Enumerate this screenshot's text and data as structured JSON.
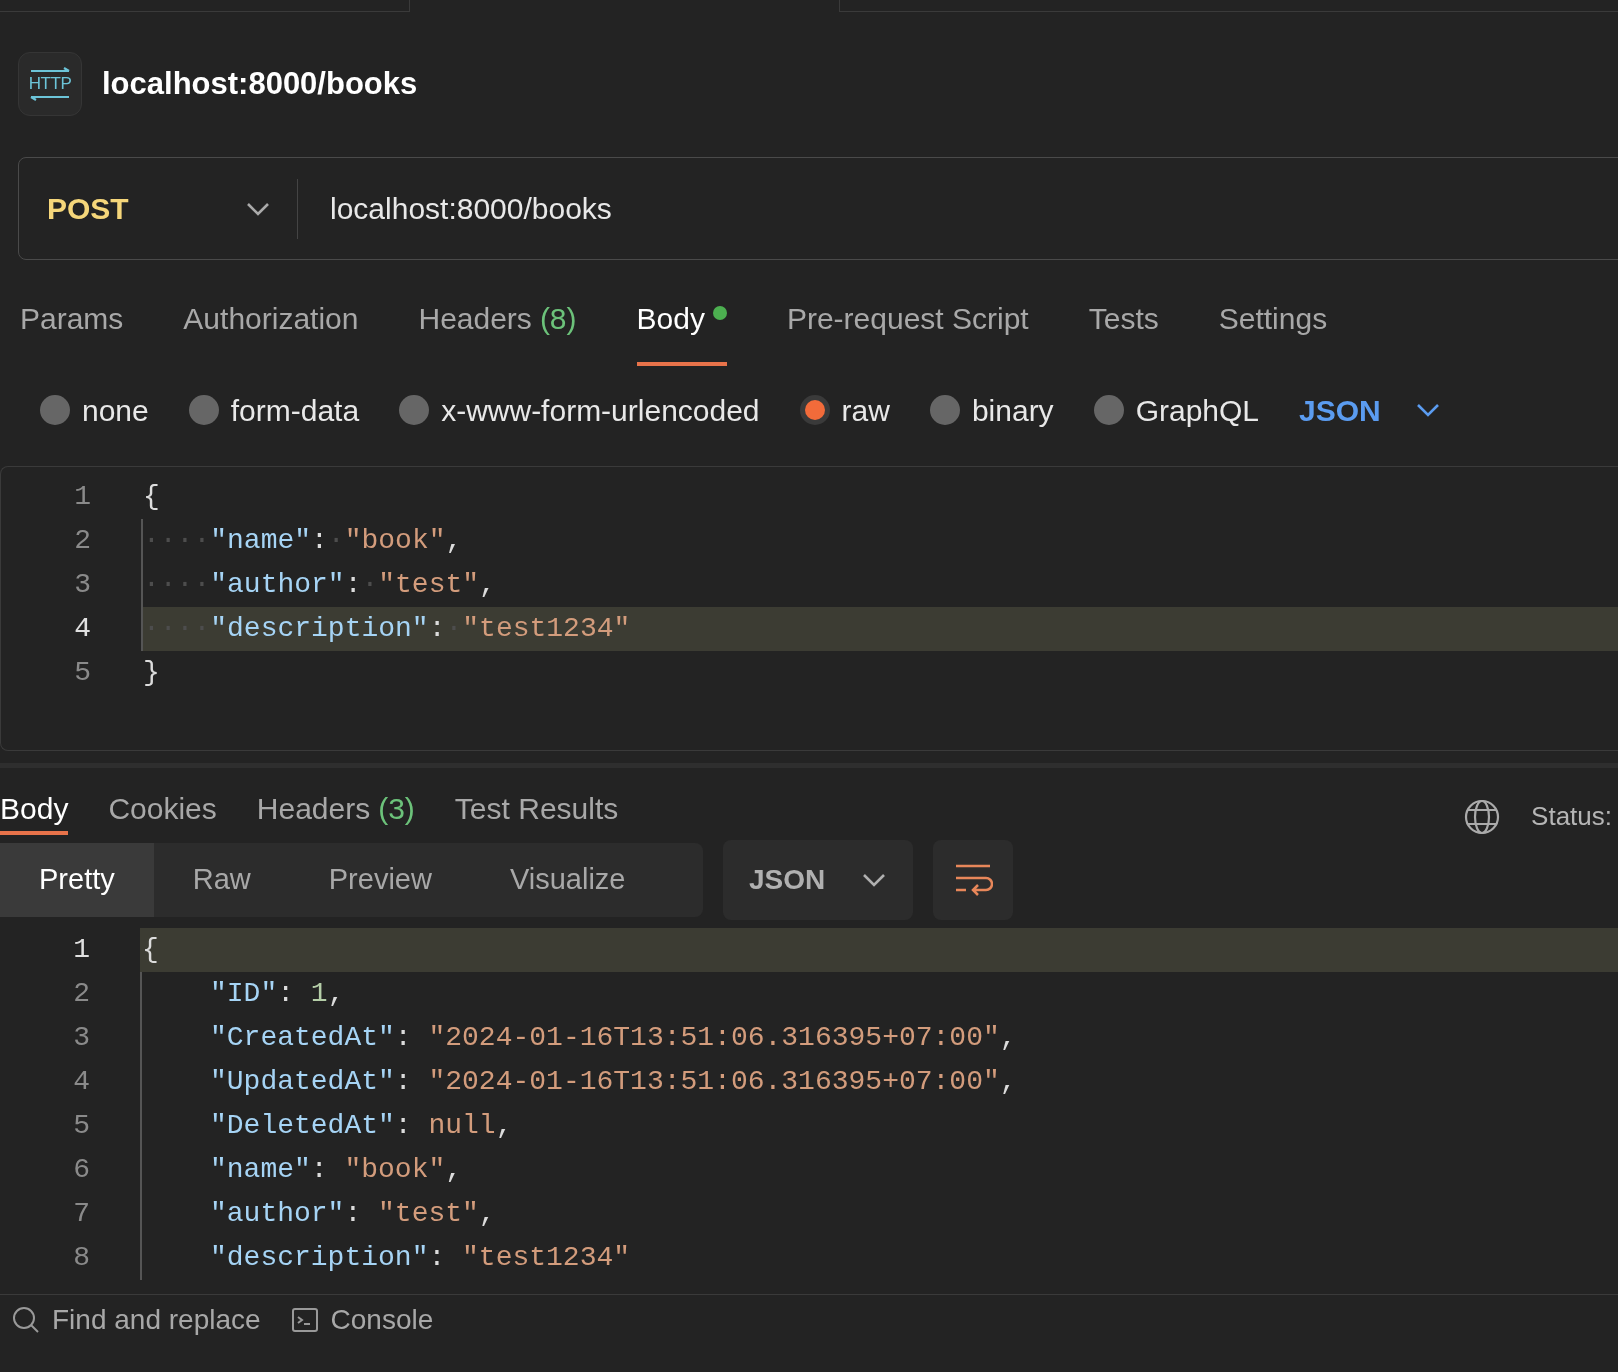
{
  "request": {
    "icon_text": "HTTP",
    "title": "localhost:8000/books",
    "method": "POST",
    "url": "localhost:8000/books",
    "tabs": [
      {
        "label": "Params",
        "selected": false
      },
      {
        "label": "Authorization",
        "selected": false
      },
      {
        "label": "Headers",
        "count": "(8)",
        "selected": false
      },
      {
        "label": "Body",
        "indicator": true,
        "selected": true
      },
      {
        "label": "Pre-request Script",
        "selected": false
      },
      {
        "label": "Tests",
        "selected": false
      },
      {
        "label": "Settings",
        "selected": false
      }
    ],
    "body_types": [
      {
        "label": "none",
        "selected": false
      },
      {
        "label": "form-data",
        "selected": false
      },
      {
        "label": "x-www-form-urlencoded",
        "selected": false
      },
      {
        "label": "raw",
        "selected": true
      },
      {
        "label": "binary",
        "selected": false
      },
      {
        "label": "GraphQL",
        "selected": false
      }
    ],
    "format": "JSON",
    "editor": {
      "lines": [
        {
          "number": "1",
          "highlighted": false,
          "tokens": [
            {
              "kind": "punct",
              "text": "{"
            }
          ]
        },
        {
          "number": "2",
          "highlighted": false,
          "tokens": [
            {
              "kind": "ws",
              "text": "····"
            },
            {
              "kind": "key",
              "text": "\"name\""
            },
            {
              "kind": "punct",
              "text": ":"
            },
            {
              "kind": "ws",
              "text": "·"
            },
            {
              "kind": "string",
              "text": "\"book\""
            },
            {
              "kind": "punct",
              "text": ","
            }
          ]
        },
        {
          "number": "3",
          "highlighted": false,
          "tokens": [
            {
              "kind": "ws",
              "text": "····"
            },
            {
              "kind": "key",
              "text": "\"author\""
            },
            {
              "kind": "punct",
              "text": ":"
            },
            {
              "kind": "ws",
              "text": "·"
            },
            {
              "kind": "string",
              "text": "\"test\""
            },
            {
              "kind": "punct",
              "text": ","
            }
          ]
        },
        {
          "number": "4",
          "highlighted": true,
          "tokens": [
            {
              "kind": "ws",
              "text": "····"
            },
            {
              "kind": "key",
              "text": "\"description\""
            },
            {
              "kind": "punct",
              "text": ":"
            },
            {
              "kind": "ws",
              "text": "·"
            },
            {
              "kind": "string",
              "text": "\"test1234\""
            }
          ]
        },
        {
          "number": "5",
          "highlighted": false,
          "tokens": [
            {
              "kind": "punct",
              "text": "}"
            }
          ]
        }
      ]
    }
  },
  "response": {
    "tabs": [
      {
        "label": "Body",
        "selected": true
      },
      {
        "label": "Cookies",
        "selected": false
      },
      {
        "label": "Headers",
        "count": "(3)",
        "selected": false
      },
      {
        "label": "Test Results",
        "selected": false
      }
    ],
    "status_label": "Status:",
    "view_modes": [
      {
        "label": "Pretty",
        "selected": true
      },
      {
        "label": "Raw",
        "selected": false
      },
      {
        "label": "Preview",
        "selected": false
      },
      {
        "label": "Visualize",
        "selected": false
      }
    ],
    "format": "JSON",
    "editor": {
      "lines": [
        {
          "number": "1",
          "highlighted": true,
          "tokens": [
            {
              "kind": "punct",
              "text": "{"
            }
          ]
        },
        {
          "number": "2",
          "highlighted": false,
          "indented": true,
          "tokens": [
            {
              "kind": "key",
              "text": "\"ID\""
            },
            {
              "kind": "punct",
              "text": ": "
            },
            {
              "kind": "number",
              "text": "1"
            },
            {
              "kind": "punct",
              "text": ","
            }
          ]
        },
        {
          "number": "3",
          "highlighted": false,
          "indented": true,
          "tokens": [
            {
              "kind": "key",
              "text": "\"CreatedAt\""
            },
            {
              "kind": "punct",
              "text": ": "
            },
            {
              "kind": "string",
              "text": "\"2024-01-16T13:51:06.316395+07:00\""
            },
            {
              "kind": "punct",
              "text": ","
            }
          ]
        },
        {
          "number": "4",
          "highlighted": false,
          "indented": true,
          "tokens": [
            {
              "kind": "key",
              "text": "\"UpdatedAt\""
            },
            {
              "kind": "punct",
              "text": ": "
            },
            {
              "kind": "string",
              "text": "\"2024-01-16T13:51:06.316395+07:00\""
            },
            {
              "kind": "punct",
              "text": ","
            }
          ]
        },
        {
          "number": "5",
          "highlighted": false,
          "indented": true,
          "tokens": [
            {
              "kind": "key",
              "text": "\"DeletedAt\""
            },
            {
              "kind": "punct",
              "text": ": "
            },
            {
              "kind": "null",
              "text": "null"
            },
            {
              "kind": "punct",
              "text": ","
            }
          ]
        },
        {
          "number": "6",
          "highlighted": false,
          "indented": true,
          "tokens": [
            {
              "kind": "key",
              "text": "\"name\""
            },
            {
              "kind": "punct",
              "text": ": "
            },
            {
              "kind": "string",
              "text": "\"book\""
            },
            {
              "kind": "punct",
              "text": ","
            }
          ]
        },
        {
          "number": "7",
          "highlighted": false,
          "indented": true,
          "tokens": [
            {
              "kind": "key",
              "text": "\"author\""
            },
            {
              "kind": "punct",
              "text": ": "
            },
            {
              "kind": "string",
              "text": "\"test\""
            },
            {
              "kind": "punct",
              "text": ","
            }
          ]
        },
        {
          "number": "8",
          "highlighted": false,
          "indented": true,
          "tokens": [
            {
              "kind": "key",
              "text": "\"description\""
            },
            {
              "kind": "punct",
              "text": ": "
            },
            {
              "kind": "string",
              "text": "\"test1234\""
            }
          ]
        }
      ]
    }
  },
  "footer": [
    {
      "kind": "search",
      "label": "Find and replace"
    },
    {
      "kind": "console",
      "label": "Console"
    }
  ]
}
